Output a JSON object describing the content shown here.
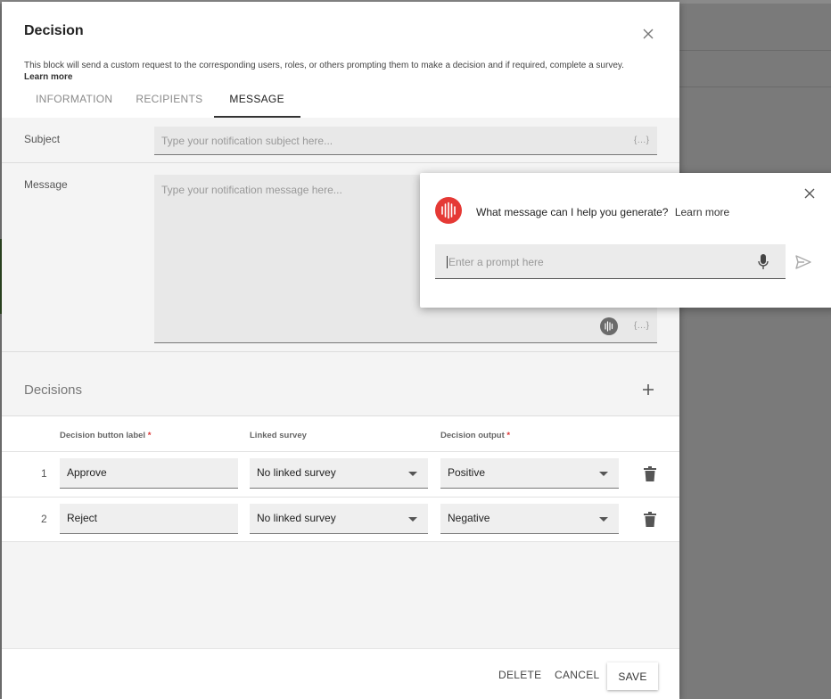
{
  "dialog": {
    "title": "Decision",
    "description": "This block will send a custom request to the corresponding users, roles, or others prompting them to make a decision and if required, complete a survey.",
    "learn_more": "Learn more",
    "tabs": [
      {
        "label": "INFORMATION",
        "active": false
      },
      {
        "label": "RECIPIENTS",
        "active": false
      },
      {
        "label": "MESSAGE",
        "active": true
      }
    ]
  },
  "message_tab": {
    "subject_label": "Subject",
    "subject_placeholder": "Type your notification subject here...",
    "message_label": "Message",
    "message_placeholder": "Type your notification message here...",
    "variable_token": "{...}"
  },
  "decisions": {
    "title": "Decisions",
    "columns": {
      "button_label": "Decision button label",
      "linked_survey": "Linked survey",
      "output": "Decision output",
      "required_mark": "*"
    },
    "rows": [
      {
        "index": "1",
        "label": "Approve",
        "survey": "No linked survey",
        "output": "Positive"
      },
      {
        "index": "2",
        "label": "Reject",
        "survey": "No linked survey",
        "output": "Negative"
      }
    ]
  },
  "footer": {
    "delete": "DELETE",
    "cancel": "CANCEL",
    "save": "SAVE"
  },
  "ai_popup": {
    "question": "What message can I help you generate?",
    "learn_more": "Learn more",
    "prompt_placeholder": "Enter a prompt here"
  },
  "colors": {
    "ai_accent": "#e53935",
    "required": "#d33333"
  },
  "icons": [
    "close-icon",
    "ai-waveform-icon",
    "plus-icon",
    "chevron-down-icon",
    "trash-icon",
    "microphone-icon",
    "send-icon"
  ]
}
